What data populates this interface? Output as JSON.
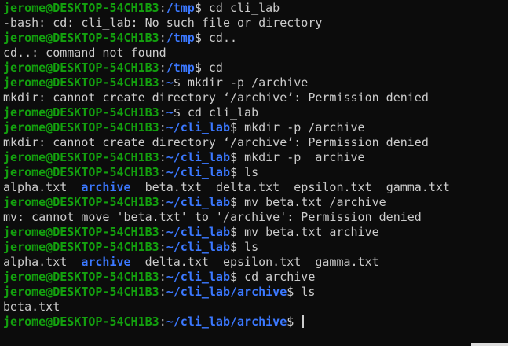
{
  "terminal": {
    "colors": {
      "background": "#0c0c0c",
      "text": "#cccccc",
      "user": "#13a10e",
      "path": "#3b78ff"
    },
    "lines": [
      {
        "type": "prompt",
        "user": "jerome@DESKTOP-54CH1B3",
        "path": "/tmp",
        "cmd": "cd cli_lab"
      },
      {
        "type": "text",
        "text": "-bash: cd: cli_lab: No such file or directory"
      },
      {
        "type": "prompt",
        "user": "jerome@DESKTOP-54CH1B3",
        "path": "/tmp",
        "cmd": "cd.."
      },
      {
        "type": "text",
        "text": "cd..: command not found"
      },
      {
        "type": "prompt",
        "user": "jerome@DESKTOP-54CH1B3",
        "path": "/tmp",
        "cmd": "cd"
      },
      {
        "type": "prompt",
        "user": "jerome@DESKTOP-54CH1B3",
        "path": "~",
        "cmd": "mkdir -p /archive"
      },
      {
        "type": "text",
        "text": "mkdir: cannot create directory ‘/archive’: Permission denied"
      },
      {
        "type": "prompt",
        "user": "jerome@DESKTOP-54CH1B3",
        "path": "~",
        "cmd": "cd cli_lab"
      },
      {
        "type": "prompt",
        "user": "jerome@DESKTOP-54CH1B3",
        "path": "~/cli_lab",
        "cmd": "mkdir -p /archive"
      },
      {
        "type": "text",
        "text": "mkdir: cannot create directory ‘/archive’: Permission denied"
      },
      {
        "type": "prompt",
        "user": "jerome@DESKTOP-54CH1B3",
        "path": "~/cli_lab",
        "cmd": "mkdir -p  archive"
      },
      {
        "type": "prompt",
        "user": "jerome@DESKTOP-54CH1B3",
        "path": "~/cli_lab",
        "cmd": "ls"
      },
      {
        "type": "listing",
        "items": [
          {
            "name": "alpha.txt",
            "dir": false
          },
          {
            "name": "archive",
            "dir": true
          },
          {
            "name": "beta.txt",
            "dir": false
          },
          {
            "name": "delta.txt",
            "dir": false
          },
          {
            "name": "epsilon.txt",
            "dir": false
          },
          {
            "name": "gamma.txt",
            "dir": false
          }
        ]
      },
      {
        "type": "prompt",
        "user": "jerome@DESKTOP-54CH1B3",
        "path": "~/cli_lab",
        "cmd": "mv beta.txt /archive"
      },
      {
        "type": "text",
        "text": "mv: cannot move 'beta.txt' to '/archive': Permission denied"
      },
      {
        "type": "prompt",
        "user": "jerome@DESKTOP-54CH1B3",
        "path": "~/cli_lab",
        "cmd": "mv beta.txt archive"
      },
      {
        "type": "prompt",
        "user": "jerome@DESKTOP-54CH1B3",
        "path": "~/cli_lab",
        "cmd": "ls"
      },
      {
        "type": "listing",
        "items": [
          {
            "name": "alpha.txt",
            "dir": false
          },
          {
            "name": "archive",
            "dir": true
          },
          {
            "name": "delta.txt",
            "dir": false
          },
          {
            "name": "epsilon.txt",
            "dir": false
          },
          {
            "name": "gamma.txt",
            "dir": false
          }
        ]
      },
      {
        "type": "prompt",
        "user": "jerome@DESKTOP-54CH1B3",
        "path": "~/cli_lab",
        "cmd": "cd archive"
      },
      {
        "type": "prompt",
        "user": "jerome@DESKTOP-54CH1B3",
        "path": "~/cli_lab/archive",
        "cmd": "ls"
      },
      {
        "type": "text",
        "text": "beta.txt"
      },
      {
        "type": "prompt",
        "user": "jerome@DESKTOP-54CH1B3",
        "path": "~/cli_lab/archive",
        "cmd": "",
        "cursor": true
      }
    ]
  }
}
